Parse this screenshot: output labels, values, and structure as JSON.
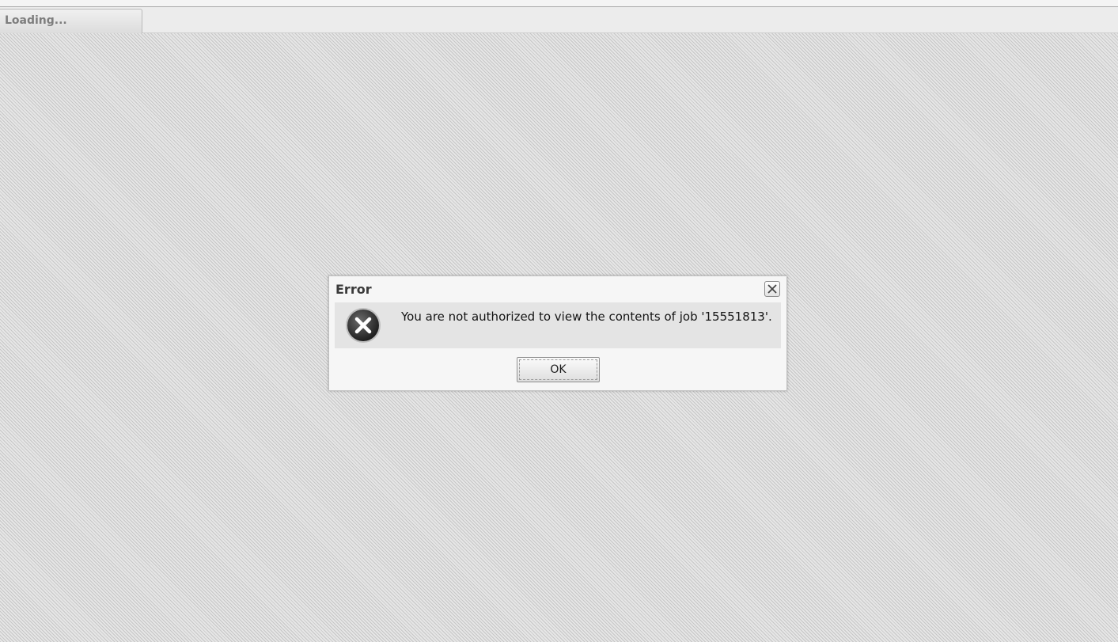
{
  "tab": {
    "label": "Loading..."
  },
  "dialog": {
    "title": "Error",
    "message": "You are not authorized to view the contents of job '15551813'.",
    "ok_label": "OK",
    "icon": "error-icon"
  },
  "colors": {
    "background_stripe_dark": "#c6c6c6",
    "background_stripe_light": "#e6e6e6",
    "dialog_background": "#f6f6f6",
    "message_panel": "#e4e4e4",
    "error_icon": "#2b2b2b"
  }
}
